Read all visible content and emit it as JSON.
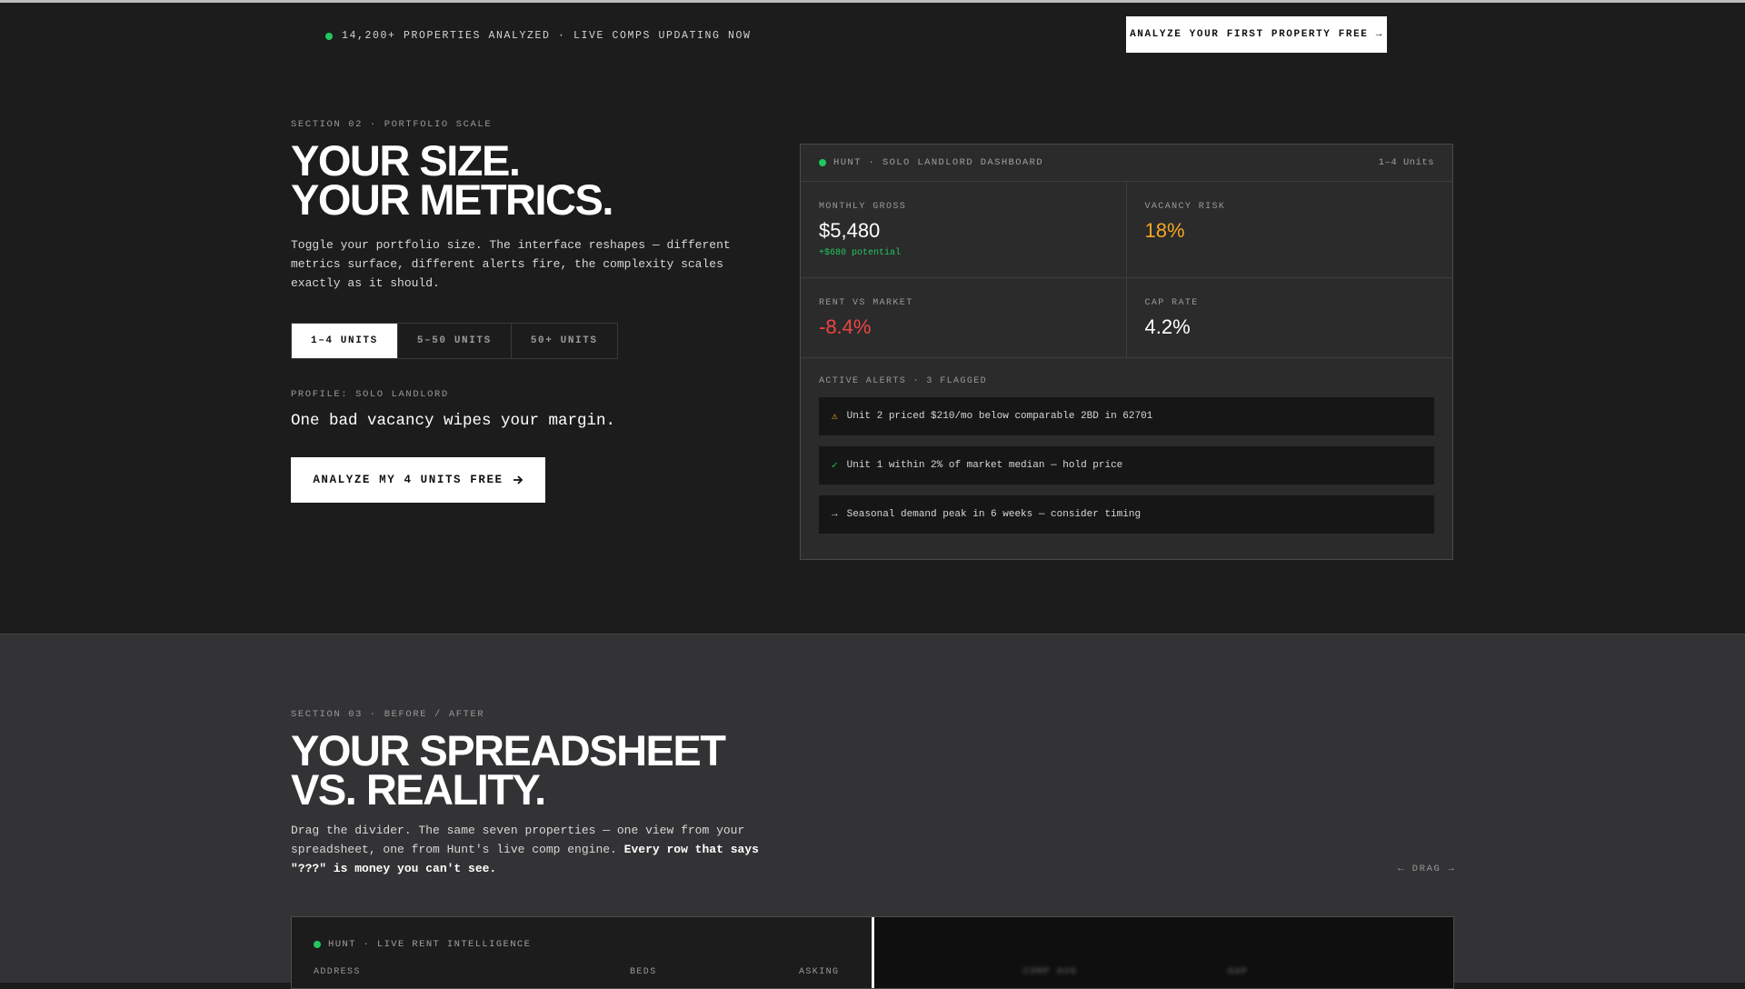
{
  "topbar": {
    "status_text": "14,200+ PROPERTIES ANALYZED · LIVE COMPS UPDATING NOW",
    "cta_label": "ANALYZE YOUR FIRST PROPERTY FREE →"
  },
  "section2": {
    "eyebrow": "SECTION 02 · PORTFOLIO SCALE",
    "title_line1": "YOUR SIZE.",
    "title_line2": "YOUR METRICS.",
    "lead": "Toggle your portfolio size. The interface reshapes — different metrics surface, different alerts fire, the complexity scales exactly as it should.",
    "toggle": [
      {
        "label": "1–4 UNITS",
        "active": true
      },
      {
        "label": "5–50 UNITS",
        "active": false
      },
      {
        "label": "50+ UNITS",
        "active": false
      }
    ],
    "profile_label": "PROFILE: SOLO LANDLORD",
    "profile_text": "One bad vacancy wipes your margin.",
    "cta_label": "ANALYZE MY 4 UNITS FREE"
  },
  "dashboard": {
    "title": "HUNT · SOLO LANDLORD DASHBOARD",
    "scope": "1–4 Units",
    "metrics": [
      {
        "label": "MONTHLY GROSS",
        "value": "$5,480",
        "sub": "+$680 potential",
        "color": "#ffffff"
      },
      {
        "label": "VACANCY RISK",
        "value": "18%",
        "sub": "",
        "color": "#f5a623"
      },
      {
        "label": "RENT VS MARKET",
        "value": "-8.4%",
        "sub": "",
        "color": "#ef4444"
      },
      {
        "label": "CAP RATE",
        "value": "4.2%",
        "sub": "",
        "color": "#ffffff"
      }
    ],
    "alerts_title": "ACTIVE ALERTS · 3 FLAGGED",
    "alerts": [
      {
        "icon": "⚠",
        "icon_name": "warning-icon",
        "icon_color": "#f5a623",
        "text": "Unit 2 priced $210/mo below comparable 2BD in 62701"
      },
      {
        "icon": "✓",
        "icon_name": "check-icon",
        "icon_color": "#22c55e",
        "text": "Unit 1 within 2% of market median — hold price"
      },
      {
        "icon": "→",
        "icon_name": "arrow-right-icon",
        "icon_color": "#d8d8d8",
        "text": "Seasonal demand peak in 6 weeks — consider timing"
      }
    ]
  },
  "section3": {
    "eyebrow": "SECTION 03 · BEFORE / AFTER",
    "title_line1": "YOUR SPREADSHEET",
    "title_line2": "VS. REALITY.",
    "lead_plain": "Drag the divider. The same seven properties — one view from your spreadsheet, one from Hunt's live comp engine. ",
    "lead_bold": "Every row that says \"???\" is money you can't see.",
    "drag_label": "← DRAG →",
    "pane_title": "HUNT · LIVE RENT INTELLIGENCE",
    "columns": [
      "ADDRESS",
      "BEDS",
      "ASKING"
    ],
    "blurred_columns": [
      "COMP AVG",
      "GAP"
    ]
  },
  "colors": {
    "accent_green": "#22c55e",
    "warning_orange": "#f5a623",
    "danger_red": "#ef4444"
  }
}
